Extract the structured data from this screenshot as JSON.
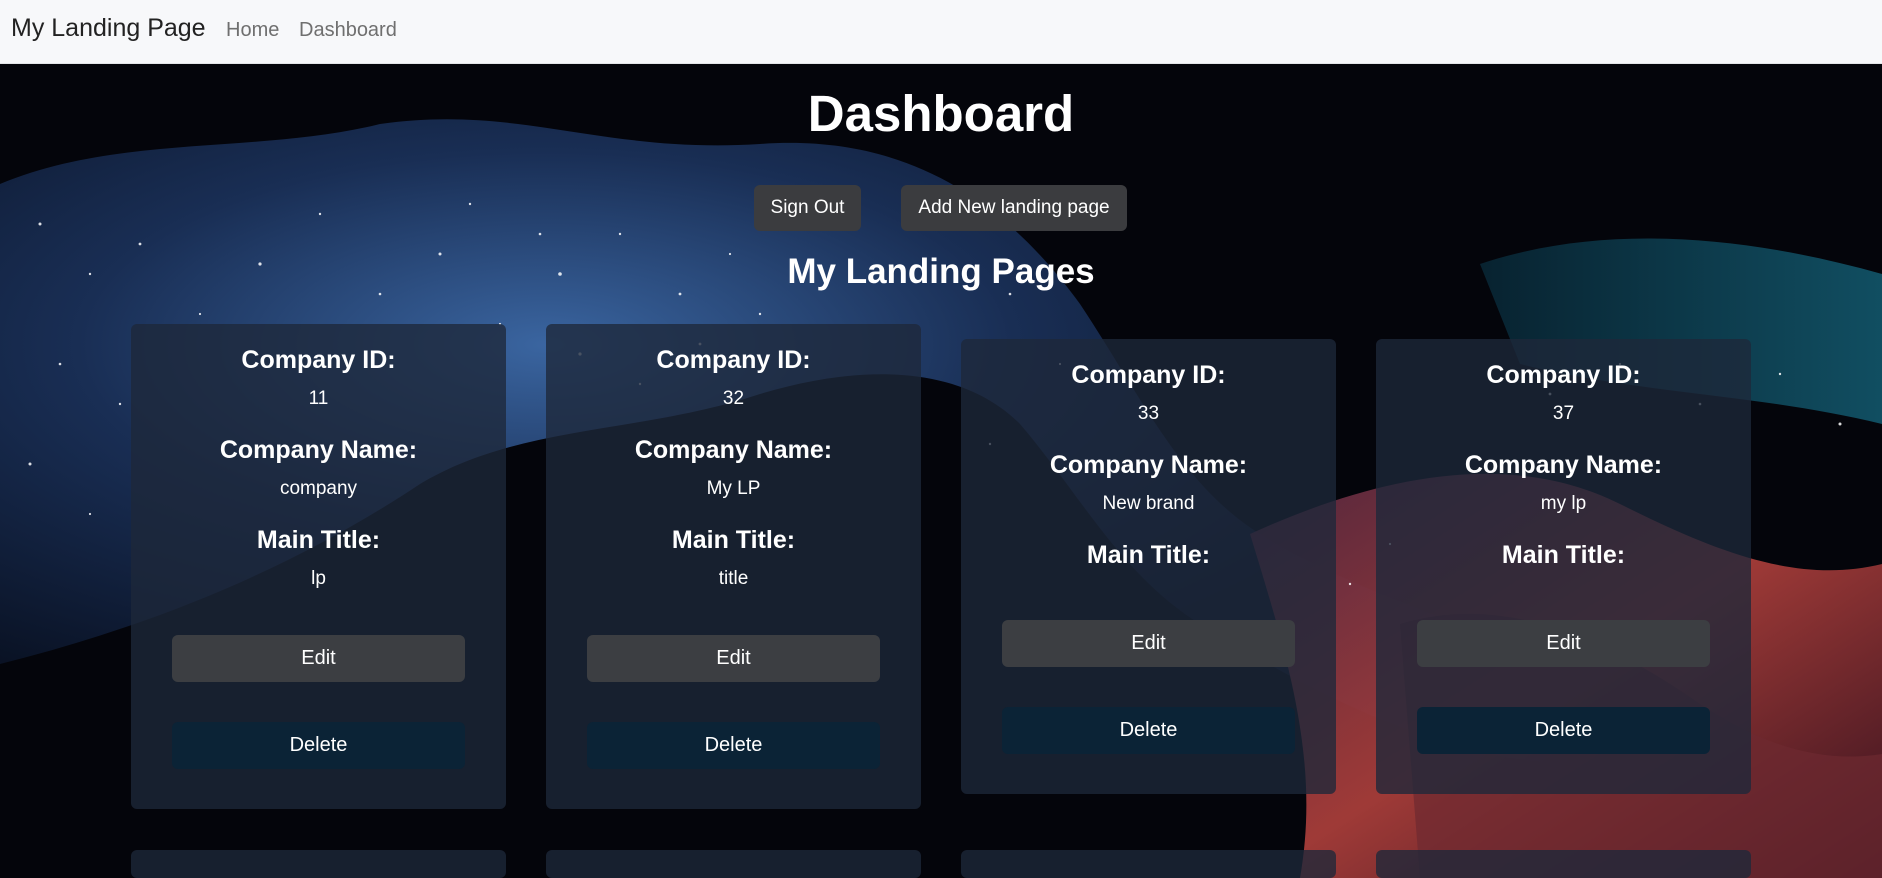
{
  "navbar": {
    "brand": "My Landing Page",
    "links": [
      "Home",
      "Dashboard"
    ]
  },
  "page": {
    "title": "Dashboard",
    "sign_out_label": "Sign Out",
    "add_new_label": "Add New landing page",
    "subtitle": "My Landing Pages"
  },
  "card_labels": {
    "company_id": "Company ID:",
    "company_name": "Company Name:",
    "main_title": "Main Title:",
    "edit": "Edit",
    "delete": "Delete"
  },
  "cards": [
    {
      "company_id": "11",
      "company_name": "company",
      "main_title": "lp"
    },
    {
      "company_id": "32",
      "company_name": "My LP",
      "main_title": "title"
    },
    {
      "company_id": "33",
      "company_name": "New brand",
      "main_title": ""
    },
    {
      "company_id": "37",
      "company_name": "my lp",
      "main_title": ""
    }
  ],
  "colors": {
    "navbar_bg": "#f7f8fa",
    "card_bg": "#1e283a",
    "edit_button": "#3c3e42",
    "delete_button": "#0b2336",
    "header_button": "#3b3c3f"
  }
}
